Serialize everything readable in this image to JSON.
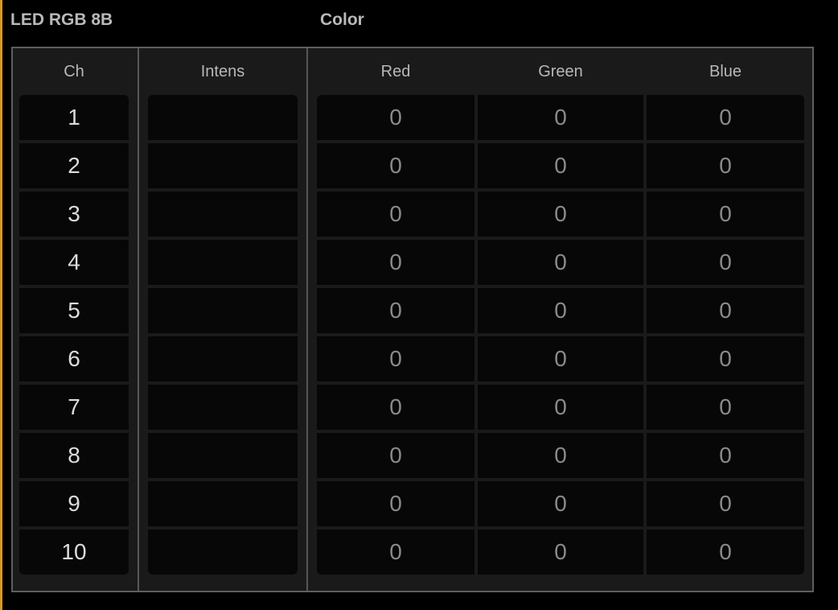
{
  "fixture": {
    "name": "LED RGB 8B"
  },
  "color_section": {
    "label": "Color"
  },
  "columns": {
    "ch": "Ch",
    "intens": "Intens",
    "red": "Red",
    "green": "Green",
    "blue": "Blue"
  },
  "rows": [
    {
      "ch": "1",
      "intens": "",
      "red": "0",
      "green": "0",
      "blue": "0"
    },
    {
      "ch": "2",
      "intens": "",
      "red": "0",
      "green": "0",
      "blue": "0"
    },
    {
      "ch": "3",
      "intens": "",
      "red": "0",
      "green": "0",
      "blue": "0"
    },
    {
      "ch": "4",
      "intens": "",
      "red": "0",
      "green": "0",
      "blue": "0"
    },
    {
      "ch": "5",
      "intens": "",
      "red": "0",
      "green": "0",
      "blue": "0"
    },
    {
      "ch": "6",
      "intens": "",
      "red": "0",
      "green": "0",
      "blue": "0"
    },
    {
      "ch": "7",
      "intens": "",
      "red": "0",
      "green": "0",
      "blue": "0"
    },
    {
      "ch": "8",
      "intens": "",
      "red": "0",
      "green": "0",
      "blue": "0"
    },
    {
      "ch": "9",
      "intens": "",
      "red": "0",
      "green": "0",
      "blue": "0"
    },
    {
      "ch": "10",
      "intens": "",
      "red": "0",
      "green": "0",
      "blue": "0"
    }
  ],
  "colors": {
    "accent": "#d89a18",
    "background": "#000000",
    "panel": "#1a1a1a",
    "cell": "#070707"
  }
}
